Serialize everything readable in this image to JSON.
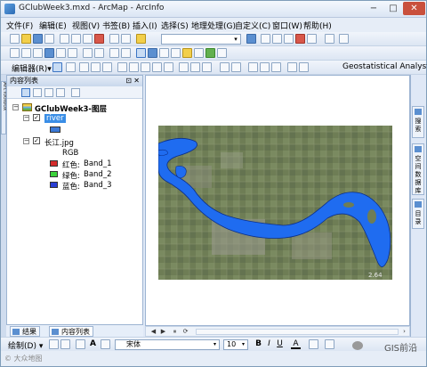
{
  "window": {
    "title": "GClubWeek3.mxd - ArcMap - ArcInfo",
    "min": "−",
    "max": "□",
    "close": "✕"
  },
  "menu": [
    {
      "label": "文件(F)"
    },
    {
      "label": "编辑(E)"
    },
    {
      "label": "视图(V)"
    },
    {
      "label": "书签(B)"
    },
    {
      "label": "插入(I)"
    },
    {
      "label": "选择(S)"
    },
    {
      "label": "地理处理(G)"
    },
    {
      "label": "自定义(C)"
    },
    {
      "label": "窗口(W)"
    },
    {
      "label": "帮助(H)"
    }
  ],
  "toolbar3": {
    "editor_label": "编辑器(R)▾",
    "geostat_label": "Geostatistical Analyst ▾"
  },
  "left_strip": {
    "arctoolbox": "ArcToolbox"
  },
  "toc": {
    "title": "内容列表",
    "pin": "⊡",
    "close": "✕",
    "data_frame": "GClubWeek3-图层",
    "layers": [
      {
        "name": "river",
        "checked": "✓",
        "swatch": "#3b79d6"
      },
      {
        "name": "长江.jpg",
        "checked": "✓",
        "render": "RGB",
        "bands": [
          {
            "channel": "红色:",
            "band": "Band_1",
            "color": "#d42b2b"
          },
          {
            "channel": "绿色:",
            "band": "Band_2",
            "color": "#3bd23b"
          },
          {
            "channel": "蓝色:",
            "band": "Band_3",
            "color": "#2a3fd4"
          }
        ]
      }
    ],
    "tabs": [
      "结果",
      "内容列表"
    ]
  },
  "right_tabs": [
    "搜索",
    "空间数据库",
    "目录"
  ],
  "map_nav": {
    "buttons": [
      "◀",
      "▶",
      "⏸",
      "⟳"
    ],
    "scroll_arrow": "›"
  },
  "drawbar": {
    "draw_label": "绘制(D) ▾",
    "text_tool": "A",
    "font_name": "宋体",
    "font_size": "10",
    "bold": "B",
    "italic": "I",
    "underline": "U",
    "font_color": "A"
  },
  "watermark": {
    "left": "© 大众地图",
    "right": "GIS前沿"
  },
  "colors": {
    "river_blue": "#1f6cf0",
    "accent": "#3a8ee6"
  },
  "map": {
    "corner_label": "2.64"
  }
}
